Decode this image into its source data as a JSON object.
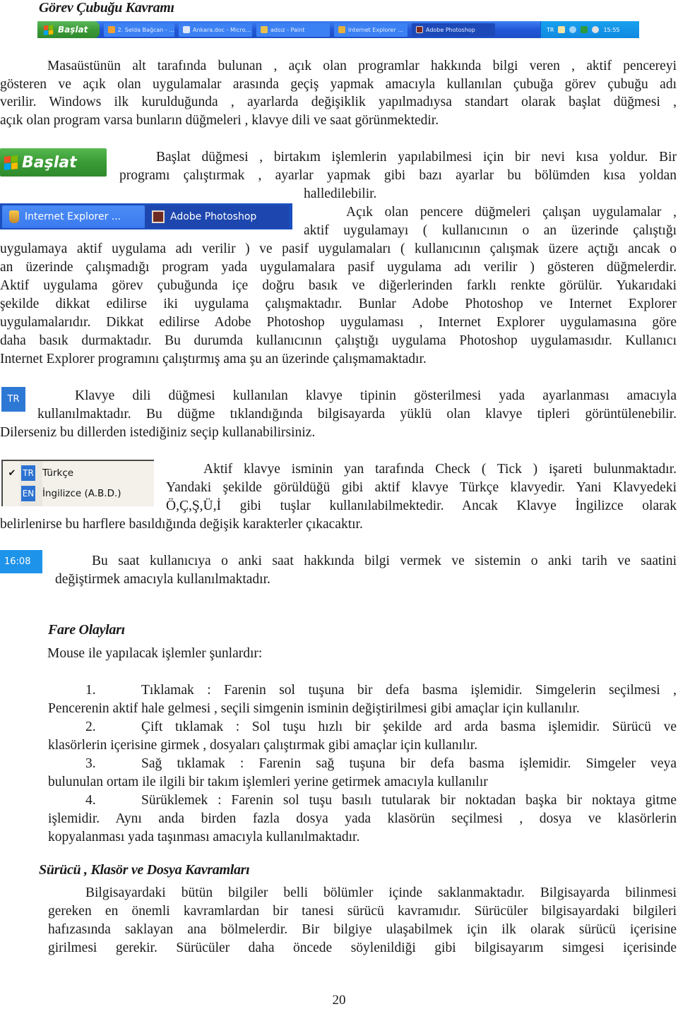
{
  "section1": {
    "heading": "Görev Çubuğu Kavramı",
    "taskbar": {
      "start_label": "Başlat",
      "buttons": [
        {
          "label": "2. Selda Bağcan - ...",
          "icon": "music-player-icon",
          "active": false
        },
        {
          "label": "Ankara.doc - Micro...",
          "icon": "word-document-icon",
          "active": false
        },
        {
          "label": "adsız - Paint",
          "icon": "paint-icon",
          "active": false
        },
        {
          "label": "Internet Explorer ...",
          "icon": "internet-explorer-icon",
          "active": false
        },
        {
          "label": "Adobe Photoshop",
          "icon": "photoshop-icon",
          "active": true
        }
      ],
      "tray": {
        "language": "TR",
        "clock": "15:55"
      }
    },
    "paragraph_lines": [
      "Masaüstünün alt tarafında bulunan , açık olan programlar hakkında bilgi veren , aktif pencereyi",
      "gösteren  ve açık olan uygulamalar arasında geçiş yapmak amacıyla kullanılan çubuğa görev çubuğu adı",
      "verilir. Windows ilk kurulduğunda , ayarlarda değişiklik yapılmadıysa standart olarak başlat düğmesi ,",
      "açık olan program varsa bunların düğmeleri , klavye dili ve saat görünmektedir."
    ]
  },
  "start_figure": {
    "label": "Başlat",
    "text_lines": [
      "Başlat düğmesi , birtakım işlemlerin yapılabilmesi için bir nevi kısa yoldur. Bir",
      "programı çalıştırmak , ayarlar yapmak gibi bazı ayarlar bu bölümden kısa yoldan",
      "halledilebilir."
    ]
  },
  "tasks_figure": {
    "buttons": [
      {
        "label": "Internet Explorer ...",
        "active": false
      },
      {
        "label": "Adobe Photoshop",
        "active": true
      }
    ],
    "text_lines": [
      "Açık olan pencere düğmeleri çalışan uygulamalar ,",
      "aktif uygulamayı ( kullanıcının o an üzerinde çalıştığı",
      "uygulamaya aktif uygulama adı verilir ) ve pasif uygulamaları ( kullanıcının çalışmak üzere açtığı ancak o",
      "an üzerinde çalışmadığı program  yada uygulamalara pasif uygulama adı verilir )  gösteren düğmelerdir.",
      "Aktif uygulama görev çubuğunda içe doğru basık ve diğerlerinden farklı renkte görülür. Yukarıdaki",
      "şekilde dikkat edilirse iki uygulama çalışmaktadır. Bunlar Adobe Photoshop ve Internet Explorer",
      "uygulamalarıdır. Dikkat edilirse Adobe Photoshop uygulaması , Internet Explorer uygulamasına göre",
      "daha basık durmaktadır. Bu durumda kullanıcının çalıştığı uygulama Photoshop uygulamasıdır. Kullanıcı",
      "Internet Explorer programını çalıştırmış ama şu an üzerinde çalışmamaktadır."
    ]
  },
  "language_figure": {
    "icon_label": "TR",
    "text_lines": [
      "Klavye dili düğmesi kullanılan klavye tipinin gösterilmesi yada ayarlanması amacıyla",
      "kullanılmaktadır. Bu düğme tıklandığında bilgisayarda yüklü olan klavye tipleri görüntülenebilir.",
      "Dilerseniz bu dillerden istediğiniz seçip kullanabilirsiniz."
    ]
  },
  "language_menu": {
    "items": [
      {
        "code": "TR",
        "label": "Türkçe",
        "checked": true
      },
      {
        "code": "EN",
        "label": "İngilizce (A.B.D.)",
        "checked": false
      }
    ],
    "check_mark": "✔",
    "text_lines": [
      "Aktif klavye isminin yan tarafında Check ( Tick ) işareti bulunmaktadır.",
      "Yandaki şekilde görüldüğü gibi aktif klavye Türkçe klavyedir. Yani Klavyedeki",
      "Ö,Ç,Ş,Ü,İ gibi tuşlar kullanılabilmektedir. Ancak Klavye İngilizce olarak",
      "belirlenirse bu harflere basıldığında değişik karakterler çıkacaktır."
    ]
  },
  "clock_figure": {
    "time": "16:08",
    "text_lines": [
      "Bu saat kullanıcıya o anki saat hakkında bilgi vermek ve sistemin o anki tarih ve saatini",
      "değiştirmek amacıyla kullanılmaktadır."
    ]
  },
  "section2": {
    "heading": "Fare Olayları",
    "intro": "Mouse ile yapılacak işlemler şunlardır:",
    "items": [
      {
        "num": "1.",
        "first_line": "Tıklamak : Farenin sol tuşuna bir defa basma işlemidir. Simgelerin seçilmesi ,",
        "rest": [
          "Pencerenin aktif hale gelmesi , seçili simgenin isminin değiştirilmesi gibi amaçlar için kullanılır."
        ]
      },
      {
        "num": "2.",
        "first_line": "Çift tıklamak : Sol tuşu hızlı bir şekilde ard arda basma işlemidir. Sürücü ve",
        "rest": [
          "klasörlerin içerisine girmek , dosyaları çalıştırmak gibi amaçlar için kullanılır."
        ]
      },
      {
        "num": "3.",
        "first_line": "Sağ tıklamak  :  Farenin sağ tuşuna bir defa basma işlemidir. Simgeler veya",
        "rest": [
          "bulunulan ortam ile ilgili bir takım işlemleri yerine getirmek amacıyla kullanılır"
        ]
      },
      {
        "num": "4.",
        "first_line": "Sürüklemek : Farenin sol tuşu basılı tutularak bir noktadan başka bir noktaya gitme",
        "rest": [
          "işlemidir. Aynı anda birden fazla dosya yada klasörün seçilmesi , dosya ve klasörlerin",
          "kopyalanması yada taşınması amacıyla kullanılmaktadır."
        ]
      }
    ]
  },
  "section3": {
    "heading": "Sürücü , Klasör ve Dosya Kavramları",
    "paragraph_lines": [
      "Bilgisayardaki bütün bilgiler belli bölümler içinde saklanmaktadır. Bilgisayarda bilinmesi",
      "gereken en önemli kavramlardan bir tanesi sürücü kavramıdır. Sürücüler bilgisayardaki bilgileri",
      "hafızasında saklayan ana bölmelerdir. Bir bilgiye ulaşabilmek için ilk olarak sürücü içerisine",
      "girilmesi gerekir. Sürücüler daha öncede söylenildiği gibi bilgisayarım simgesi içerisinde"
    ]
  },
  "page_number": "20"
}
